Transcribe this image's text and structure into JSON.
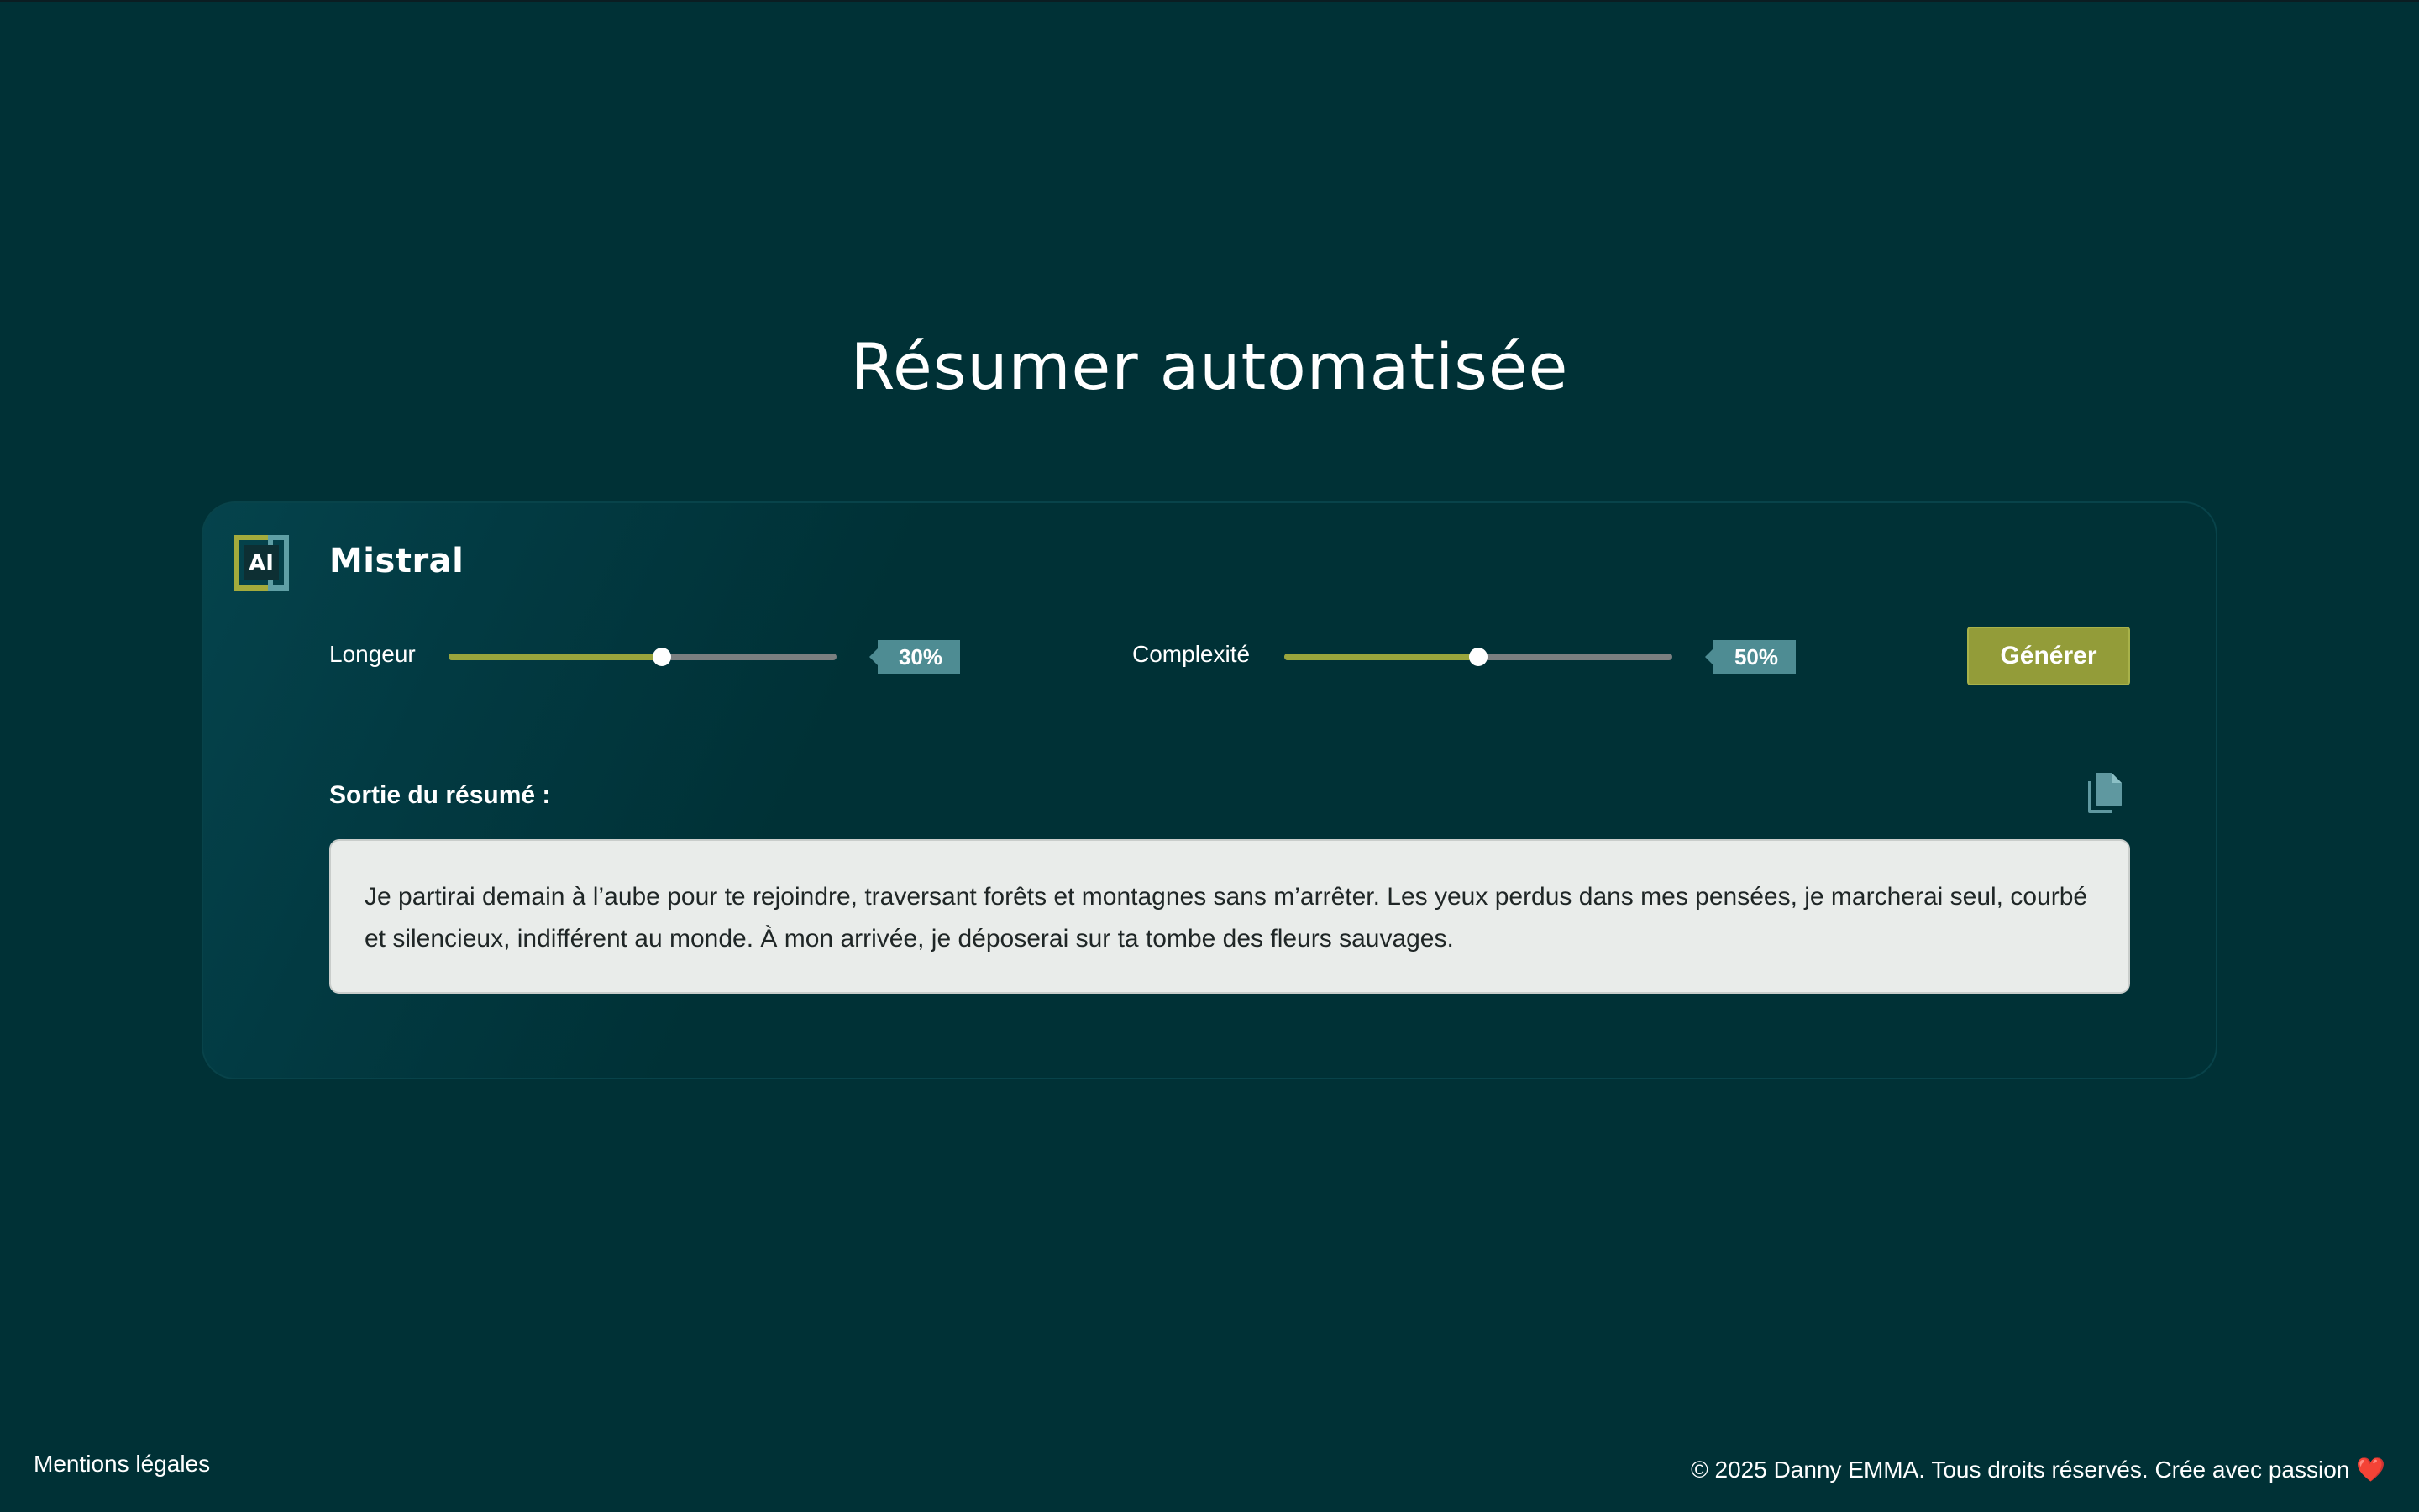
{
  "page": {
    "title": "Résumer automatisée"
  },
  "model": {
    "logo_text": "AI",
    "name": "Mistral"
  },
  "controls": {
    "length": {
      "label": "Longeur",
      "value_label": "30%"
    },
    "complexity": {
      "label": "Complexité",
      "value_label": "50%",
      "level": 0.5
    },
    "generate_label": "Générer"
  },
  "output": {
    "label": "Sortie du résumé :",
    "text": "Je partirai demain à l’aube pour te rejoindre, traversant forêts et montagnes sans m’arrêter. Les yeux perdus dans mes pensées, je marcherai seul, courbé et silencieux, indifférent au monde. À mon arrivée, je déposerai sur ta tombe des fleurs sauvages.",
    "copy_icon": "copy-icon"
  },
  "footer": {
    "legal_label": "Mentions légales",
    "copyright": "© 2025 Danny EMMA. Tous droits réservés. Crée avec passion",
    "heart": "❤️"
  },
  "colors": {
    "background": "#003136",
    "accent_olive": "#939c39",
    "badge_teal": "#4e8c93",
    "output_bg": "#e9ecea"
  }
}
